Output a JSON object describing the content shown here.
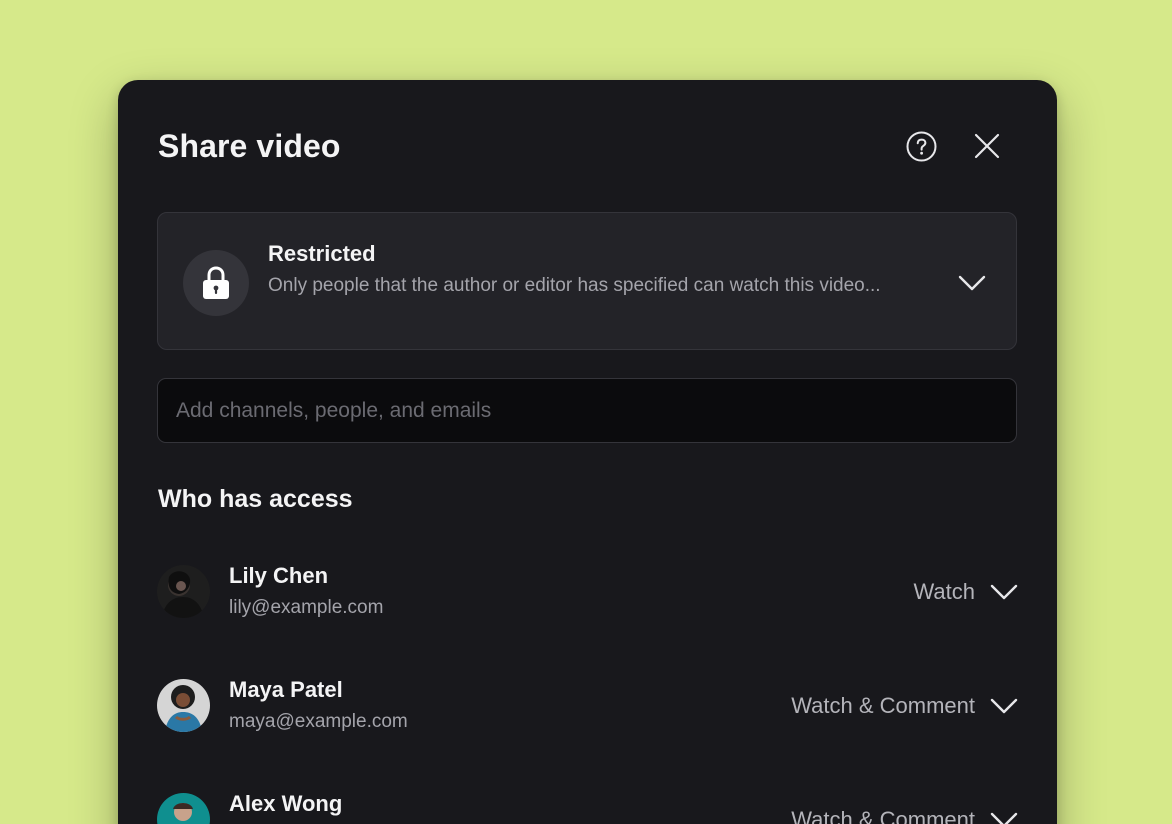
{
  "dialog": {
    "title": "Share video",
    "help_icon": "question-circle-icon",
    "close_icon": "close-icon"
  },
  "general_access": {
    "title": "Restricted",
    "description": "Only people that the author or editor has specified can watch this video...",
    "icon": "lock-icon",
    "dropdown_icon": "chevron-down-icon"
  },
  "invite": {
    "placeholder": "Add channels, people, and emails"
  },
  "access_section": {
    "title": "Who has access",
    "people": [
      {
        "name": "Lily Chen",
        "email": "lily@example.com",
        "role": "Watch",
        "avatar_color": "#2b2b2b"
      },
      {
        "name": "Maya Patel",
        "email": "maya@example.com",
        "role": "Watch & Comment",
        "avatar_color": "#3a7ea6"
      },
      {
        "name": "Alex Wong",
        "email": "",
        "role": "Watch & Comment",
        "avatar_color": "#0f8f8f"
      }
    ]
  },
  "colors": {
    "page_background": "#d6e98a",
    "modal_background": "#18181c",
    "card_background": "#232328",
    "input_background": "#0b0b0d"
  }
}
